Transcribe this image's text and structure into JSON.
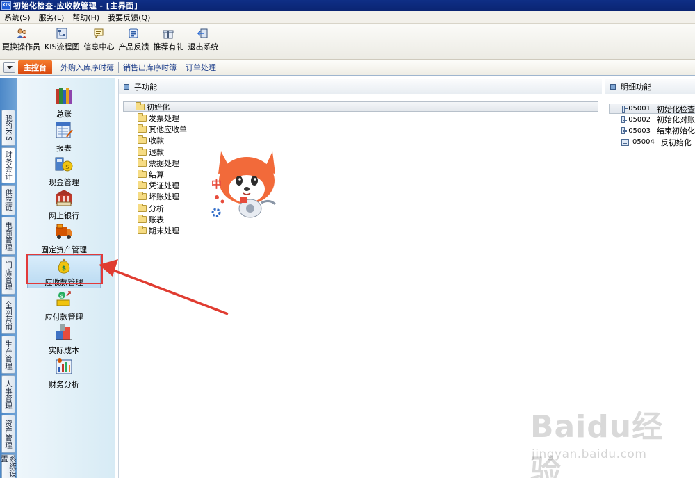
{
  "window": {
    "title": "初始化检查-应收款管理 - [主界面]",
    "logo_text": "KIS"
  },
  "menu": [
    {
      "label": "系统(S)"
    },
    {
      "label": "服务(L)"
    },
    {
      "label": "帮助(H)"
    },
    {
      "label": "我要反馈(Q)"
    }
  ],
  "toolbar": [
    {
      "label": "更换操作员",
      "icon": "user-switch-icon"
    },
    {
      "label": "KIS流程图",
      "icon": "flowchart-icon"
    },
    {
      "label": "信息中心",
      "icon": "message-icon"
    },
    {
      "label": "产品反馈",
      "icon": "feedback-icon"
    },
    {
      "label": "推荐有礼",
      "icon": "gift-icon"
    },
    {
      "label": "退出系统",
      "icon": "exit-icon"
    }
  ],
  "tabs": {
    "active": "主控台",
    "items": [
      "外购入库序时簿",
      "销售出库序时簿",
      "订单处理"
    ]
  },
  "vertical_tabs": [
    "我的KIS",
    "财务会计",
    "供应链",
    "电商管理",
    "门店管理",
    "全网营销",
    "生产管理",
    "人事管理",
    "资产管理",
    "系统设置"
  ],
  "modules": [
    {
      "label": "总账",
      "icon": "ledger-books-icon"
    },
    {
      "label": "报表",
      "icon": "report-icon"
    },
    {
      "label": "现金管理",
      "icon": "cash-management-icon"
    },
    {
      "label": "网上银行",
      "icon": "online-bank-icon"
    },
    {
      "label": "固定资产管理",
      "icon": "fixed-asset-truck-icon"
    },
    {
      "label": "应收款管理",
      "icon": "money-bag-icon",
      "selected": true
    },
    {
      "label": "应付款管理",
      "icon": "payable-icon"
    },
    {
      "label": "实际成本",
      "icon": "cost-icon"
    },
    {
      "label": "财务分析",
      "icon": "financial-analysis-icon"
    }
  ],
  "subfunction": {
    "header": "子功能",
    "items": [
      "初始化",
      "发票处理",
      "其他应收单",
      "收款",
      "退款",
      "票据处理",
      "结算",
      "凭证处理",
      "坏账处理",
      "分析",
      "账表",
      "期末处理"
    ]
  },
  "detail": {
    "header": "明细功能",
    "items": [
      {
        "code": "05001",
        "name": "初始化检查"
      },
      {
        "code": "05002",
        "name": "初始化对账"
      },
      {
        "code": "05003",
        "name": "结束初始化"
      },
      {
        "code": "05004",
        "name": "反初始化"
      }
    ]
  },
  "watermark": {
    "text": "Baidu经验",
    "url": "jingyan.baidu.com"
  },
  "colors": {
    "title_bar": "#0f2f86",
    "active_tab": "#e85a1c",
    "highlight": "#e23a3a",
    "sidebar": "#5a94cd"
  }
}
